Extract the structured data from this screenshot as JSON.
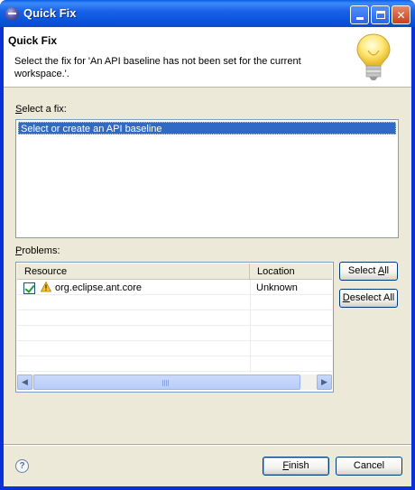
{
  "window": {
    "title": "Quick Fix"
  },
  "header": {
    "title": "Quick Fix",
    "message": "Select the fix for 'An API baseline has not been set for the current workspace.'."
  },
  "fixes": {
    "label_pre": "",
    "label_key": "S",
    "label_rest": "elect a fix:",
    "items": [
      "Select or create an API baseline"
    ]
  },
  "problems": {
    "label_key": "P",
    "label_rest": "roblems:",
    "columns": [
      "Resource",
      "Location"
    ],
    "rows": [
      {
        "checked": true,
        "icon": "warning-icon",
        "resource": "org.eclipse.ant.core",
        "location": "Unknown"
      }
    ]
  },
  "buttons": {
    "select_all_pre": "Select ",
    "select_all_key": "A",
    "select_all_post": "ll",
    "deselect_all_pre": "",
    "deselect_all_key": "D",
    "deselect_all_post": "eselect All",
    "finish_key": "F",
    "finish_rest": "inish",
    "cancel": "Cancel"
  },
  "help": {
    "glyph": "?"
  }
}
